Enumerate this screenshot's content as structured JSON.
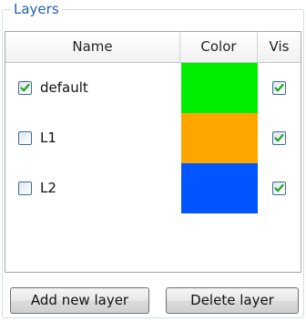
{
  "group": {
    "title": "Layers"
  },
  "table": {
    "headers": {
      "name": "Name",
      "color": "Color",
      "vis": "Vis"
    },
    "rows": [
      {
        "name": "default",
        "selected": true,
        "color": "#00ee00",
        "visible": true
      },
      {
        "name": "L1",
        "selected": false,
        "color": "#ffa500",
        "visible": true
      },
      {
        "name": "L2",
        "selected": false,
        "color": "#0055ff",
        "visible": true
      }
    ]
  },
  "buttons": {
    "add": "Add new layer",
    "delete": "Delete layer"
  }
}
